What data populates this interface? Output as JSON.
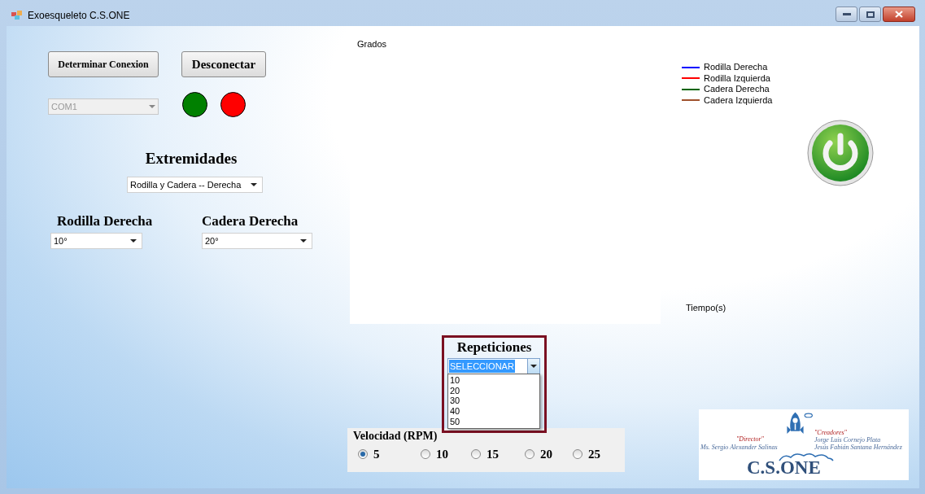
{
  "window": {
    "title": "Exoesqueleto  C.S.ONE"
  },
  "connection": {
    "connect_button": "Determinar Conexion",
    "disconnect_button": "Desconectar",
    "port": {
      "value": "COM1",
      "disabled": true
    },
    "lights": [
      {
        "color": "#008000"
      },
      {
        "color": "#ff0000"
      }
    ]
  },
  "extremidades": {
    "label": "Extremidades",
    "value": "Rodilla y Cadera -- Derecha"
  },
  "joints": [
    {
      "label": "Rodilla Derecha",
      "value": "10°"
    },
    {
      "label": "Cadera Derecha",
      "value": "20°"
    }
  ],
  "chart": {
    "ylabel": "Grados",
    "xlabel": "Tiempo(s)",
    "legend": [
      {
        "label": "Rodilla Derecha",
        "color": "#0000ff"
      },
      {
        "label": "Rodilla Izquierda",
        "color": "#ff0000"
      },
      {
        "label": "Cadera Derecha",
        "color": "#006400"
      },
      {
        "label": "Cadera Izquierda",
        "color": "#a0522d"
      }
    ]
  },
  "repeticiones": {
    "label": "Repeticiones",
    "value": "SELECCIONAR",
    "expanded": true,
    "options": [
      "10",
      "20",
      "30",
      "40",
      "50"
    ]
  },
  "velocidad": {
    "label": "Velocidad (RPM)",
    "options": [
      {
        "label": "5",
        "selected": true
      },
      {
        "label": "10",
        "selected": false
      },
      {
        "label": "15",
        "selected": false
      },
      {
        "label": "20",
        "selected": false
      },
      {
        "label": "25",
        "selected": false
      }
    ]
  },
  "logo": {
    "director_title": "\"Director\"",
    "director": "Ms. Sergio Alexander Salinas",
    "creators_title": "\"Creadores\"",
    "creators": [
      "Jorge Luis Cornejo Plata",
      "Jesús Fabián Santana Hernández"
    ],
    "name": "C.S.ONE"
  }
}
